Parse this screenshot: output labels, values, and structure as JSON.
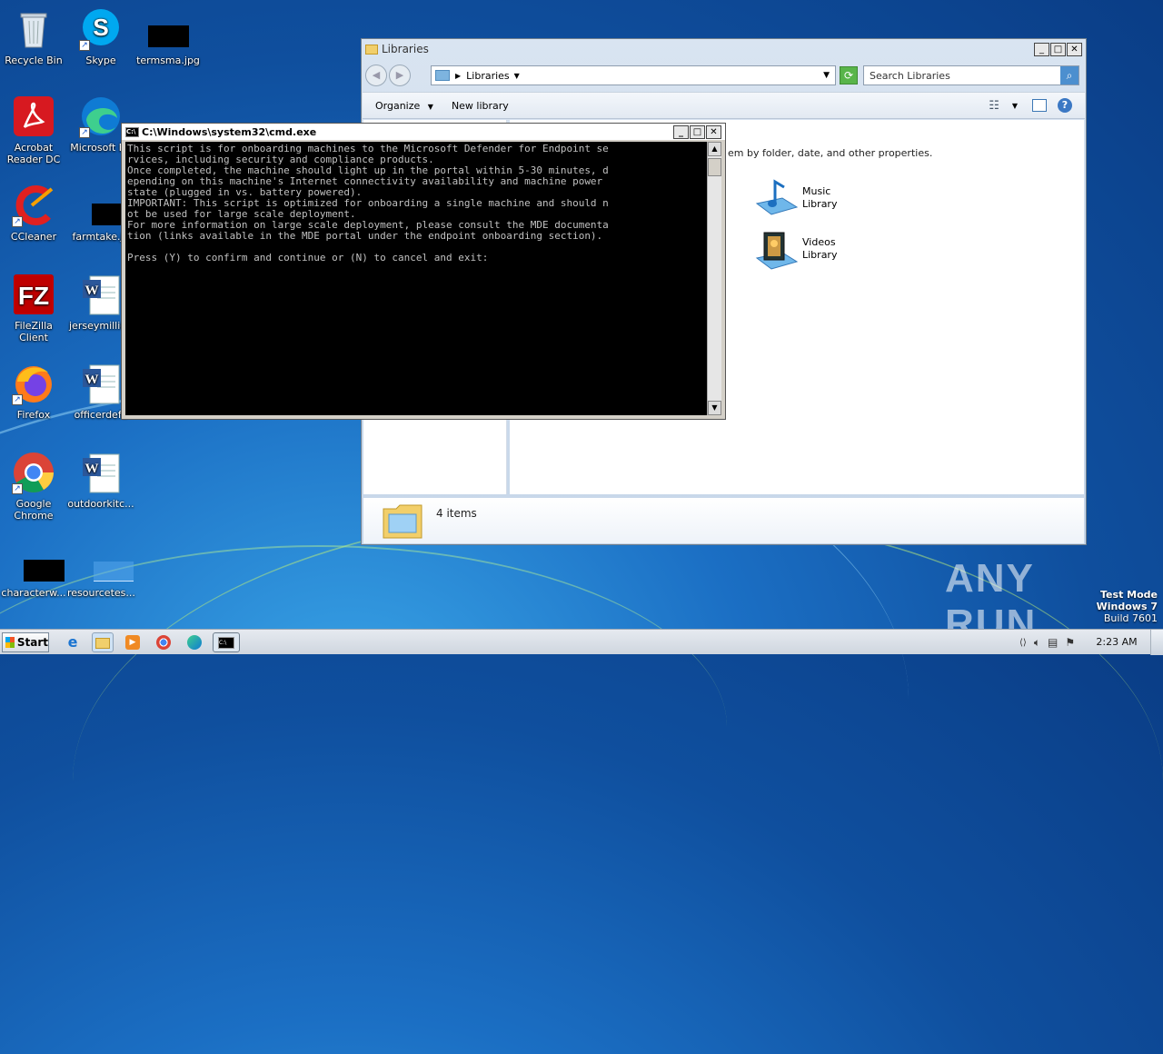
{
  "desktop": {
    "icons": [
      {
        "label": "Recycle Bin"
      },
      {
        "label": "Skype"
      },
      {
        "label": "termsma.jpg"
      },
      {
        "label": "Acrobat Reader DC"
      },
      {
        "label": "Microsoft Ed"
      },
      {
        "label": "CCleaner"
      },
      {
        "label": "farmtake.jp"
      },
      {
        "label": "FileZilla Client"
      },
      {
        "label": "jerseymillion"
      },
      {
        "label": "Firefox"
      },
      {
        "label": "officerdefa"
      },
      {
        "label": "Google Chrome"
      },
      {
        "label": "outdoorkitc..."
      },
      {
        "label": "characterw..."
      },
      {
        "label": "resourcetes..."
      }
    ],
    "watermark": {
      "brand": "ANY RUN",
      "line1": "Test Mode",
      "line2": "Windows 7",
      "line3": "Build 7601"
    }
  },
  "explorer": {
    "title": "Libraries",
    "breadcrumb": "Libraries",
    "search_placeholder": "Search Libraries",
    "toolbar": {
      "organize": "Organize",
      "new_library": "New library"
    },
    "hint_text": "em by folder, date, and other properties.",
    "items": [
      {
        "line1": "Music",
        "line2": "Library",
        "icon": "music-library-icon"
      },
      {
        "line1": "Videos",
        "line2": "Library",
        "icon": "videos-library-icon"
      }
    ],
    "status": "4 items"
  },
  "cmd": {
    "title": "C:\\Windows\\system32\\cmd.exe",
    "lines": [
      "This script is for onboarding machines to the Microsoft Defender for Endpoint se",
      "rvices, including security and compliance products.",
      "Once completed, the machine should light up in the portal within 5-30 minutes, d",
      "epending on this machine's Internet connectivity availability and machine power",
      "state (plugged in vs. battery powered).",
      "IMPORTANT: This script is optimized for onboarding a single machine and should n",
      "ot be used for large scale deployment.",
      "For more information on large scale deployment, please consult the MDE documenta",
      "tion (links available in the MDE portal under the endpoint onboarding section).",
      "",
      "Press (Y) to confirm and continue or (N) to cancel and exit:"
    ]
  },
  "taskbar": {
    "start_label": "Start",
    "clock": "2:23 AM"
  },
  "colors": {
    "cmd_text": "#c0c0c0",
    "cmd_bg": "#000000",
    "desktop": "#1b6fc4"
  }
}
